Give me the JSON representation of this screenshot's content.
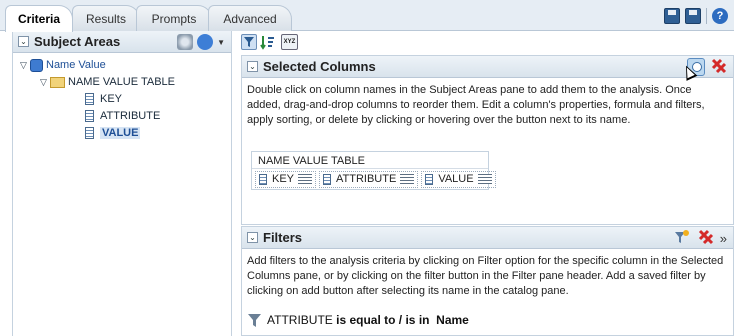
{
  "tabs": [
    {
      "label": "Criteria",
      "active": true
    },
    {
      "label": "Results",
      "active": false
    },
    {
      "label": "Prompts",
      "active": false
    },
    {
      "label": "Advanced",
      "active": false
    }
  ],
  "tab_toolbar": {
    "icons": [
      "save-icon",
      "save-as-icon",
      "help-icon"
    ],
    "help_glyph": "?"
  },
  "subject_areas": {
    "title": "Subject Areas",
    "tools": [
      "column-properties-icon",
      "refresh-icon",
      "chevron-down-icon"
    ],
    "tree": {
      "root": {
        "label": "Name Value"
      },
      "table": {
        "label": "NAME VALUE TABLE"
      },
      "columns": [
        {
          "label": "KEY",
          "selected": false
        },
        {
          "label": "ATTRIBUTE",
          "selected": false
        },
        {
          "label": "VALUE",
          "selected": true
        }
      ]
    }
  },
  "criteria_toolbar": {
    "icons": [
      "filter-icon",
      "sort-icon",
      "xyz-icon"
    ],
    "xyz_label": "XYZ"
  },
  "selected_columns": {
    "title": "Selected Columns",
    "description": "Double click on column names in the Subject Areas pane to add them to the analysis. Once added, drag-and-drop columns to reorder them. Edit a column's properties, formula and filters, apply sorting, or delete by clicking or hovering over the button next to its name.",
    "table_name": "NAME VALUE TABLE",
    "columns": [
      "KEY",
      "ATTRIBUTE",
      "VALUE"
    ]
  },
  "filters": {
    "title": "Filters",
    "description": "Add filters to the analysis criteria by clicking on Filter option for the specific column in the Selected Columns pane, or by clicking on the filter button in the Filter pane header. Add a saved filter by clicking on add button after selecting its name in the catalog pane.",
    "item": {
      "column": "ATTRIBUTE",
      "operator": "is equal to / is in",
      "value": "Name"
    },
    "more_glyph": "»"
  },
  "colors": {
    "accent": "#3e7bd0",
    "header_bg": "#d9e3ec",
    "remove_red": "#d42a2a"
  }
}
